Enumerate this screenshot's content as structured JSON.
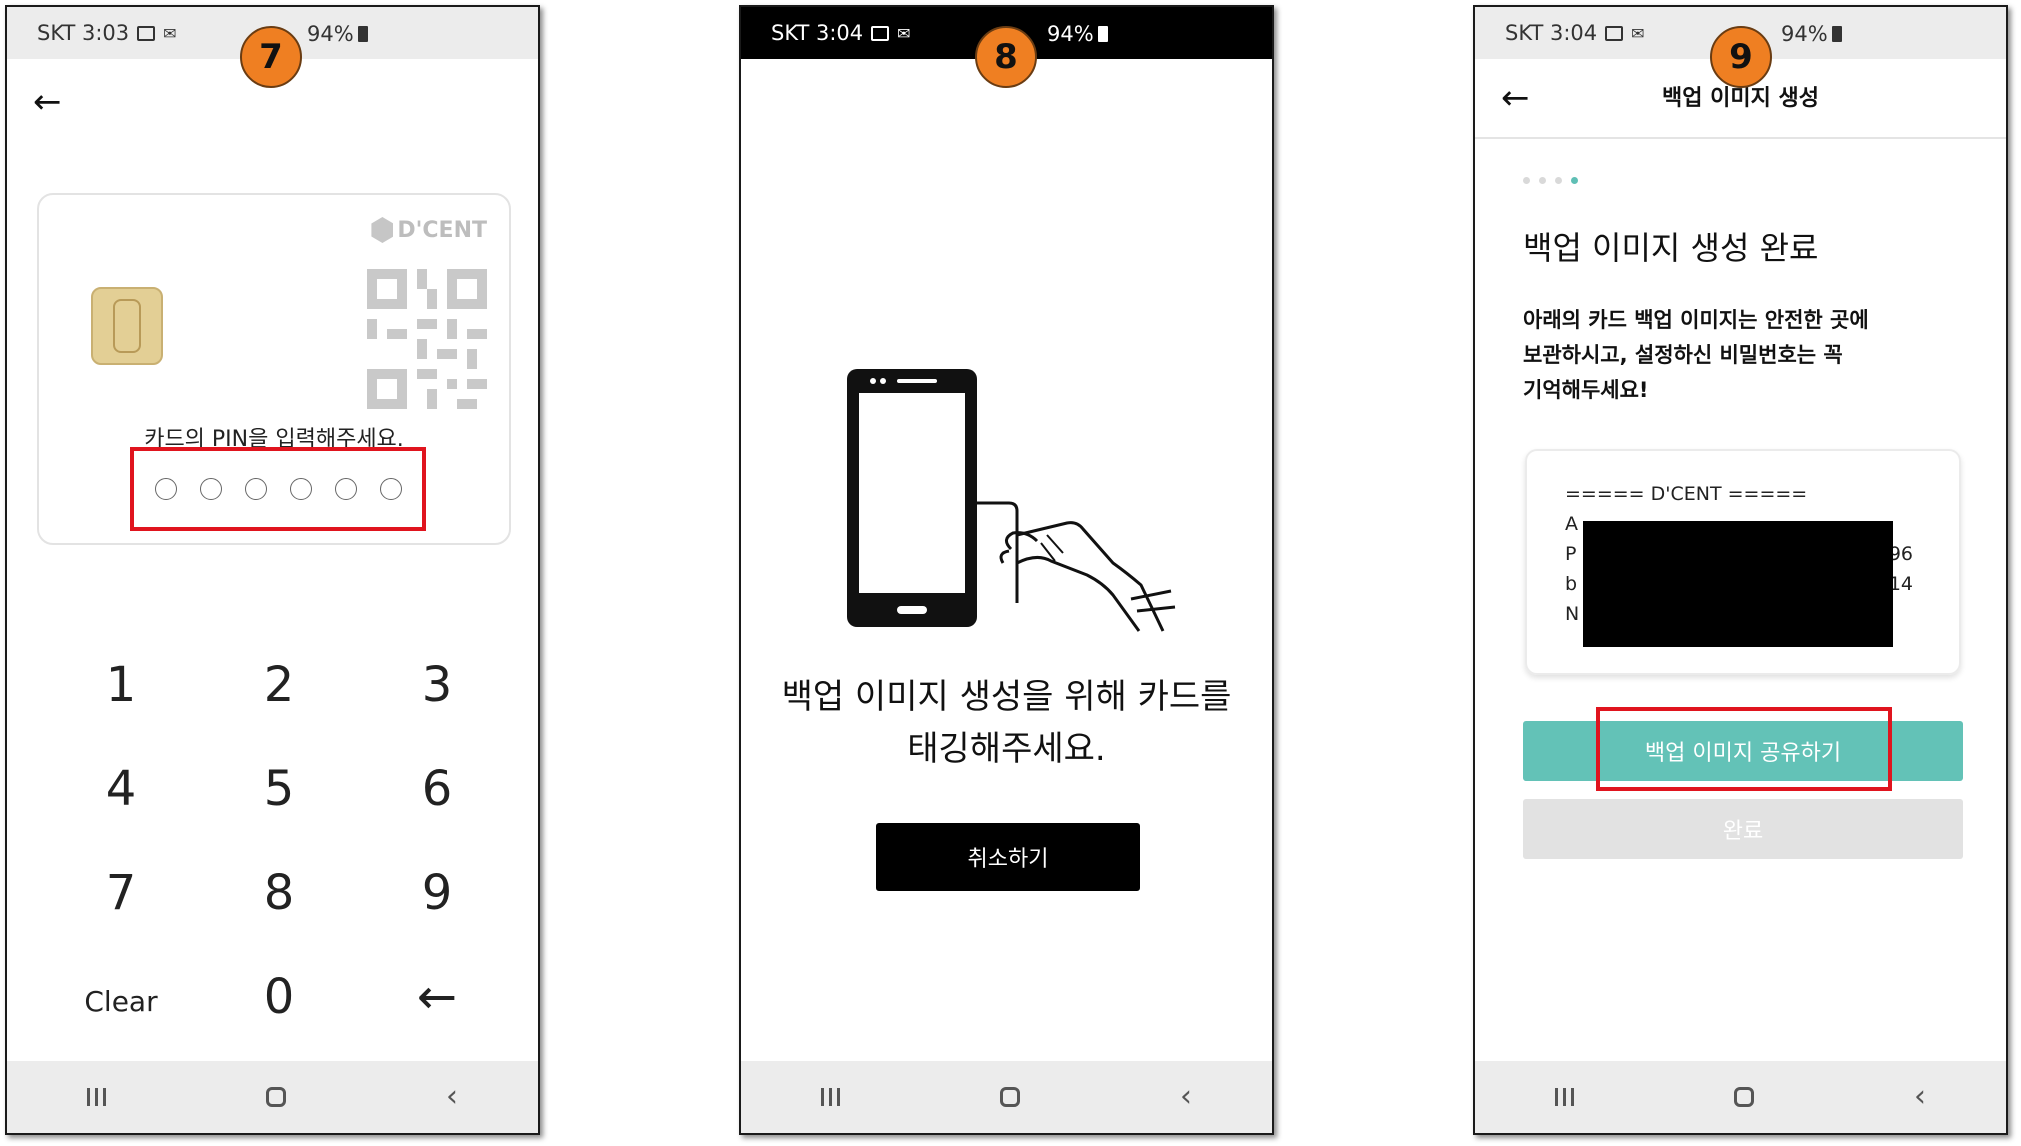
{
  "colors": {
    "badge": "#ef7f22",
    "highlight": "#e0141e",
    "accent": "#63c2b7",
    "disabled": "#e2e2e2"
  },
  "screen1": {
    "step": "7",
    "status": {
      "carrier_time": "SKT 3:03",
      "battery": "94%"
    },
    "card_logo": "D'CENT",
    "pin_label": "카드의 PIN을 입력해주세요.",
    "keys": {
      "k1": "1",
      "k2": "2",
      "k3": "3",
      "k4": "4",
      "k5": "5",
      "k6": "6",
      "k7": "7",
      "k8": "8",
      "k9": "9",
      "clear": "Clear",
      "k0": "0"
    },
    "backspace_icon": "arrow-left-icon"
  },
  "screen2": {
    "step": "8",
    "status": {
      "carrier_time": "SKT 3:04",
      "battery": "94%"
    },
    "message_line1": "백업 이미지 생성을 위해 카드를",
    "message_line2": "태깅해주세요.",
    "cancel": "취소하기"
  },
  "screen3": {
    "step": "9",
    "status": {
      "carrier_time": "SKT 3:04",
      "battery": "94%"
    },
    "title": "백업 이미지 생성",
    "heading": "백업 이미지 생성 완료",
    "desc_line1": "아래의 카드 백업 이미지는 안전한 곳에",
    "desc_line2": "보관하시고, 설정하신 비밀번호는 꼭",
    "desc_line3": "기억해두세요!",
    "code": {
      "header": "===== D'CENT =====",
      "line2_start": "A",
      "line3_start": "P",
      "line3_end": "96",
      "line4_start": "b",
      "line4_end": "14",
      "line5_start": "N"
    },
    "share": "백업 이미지 공유하기",
    "done": "완료"
  }
}
